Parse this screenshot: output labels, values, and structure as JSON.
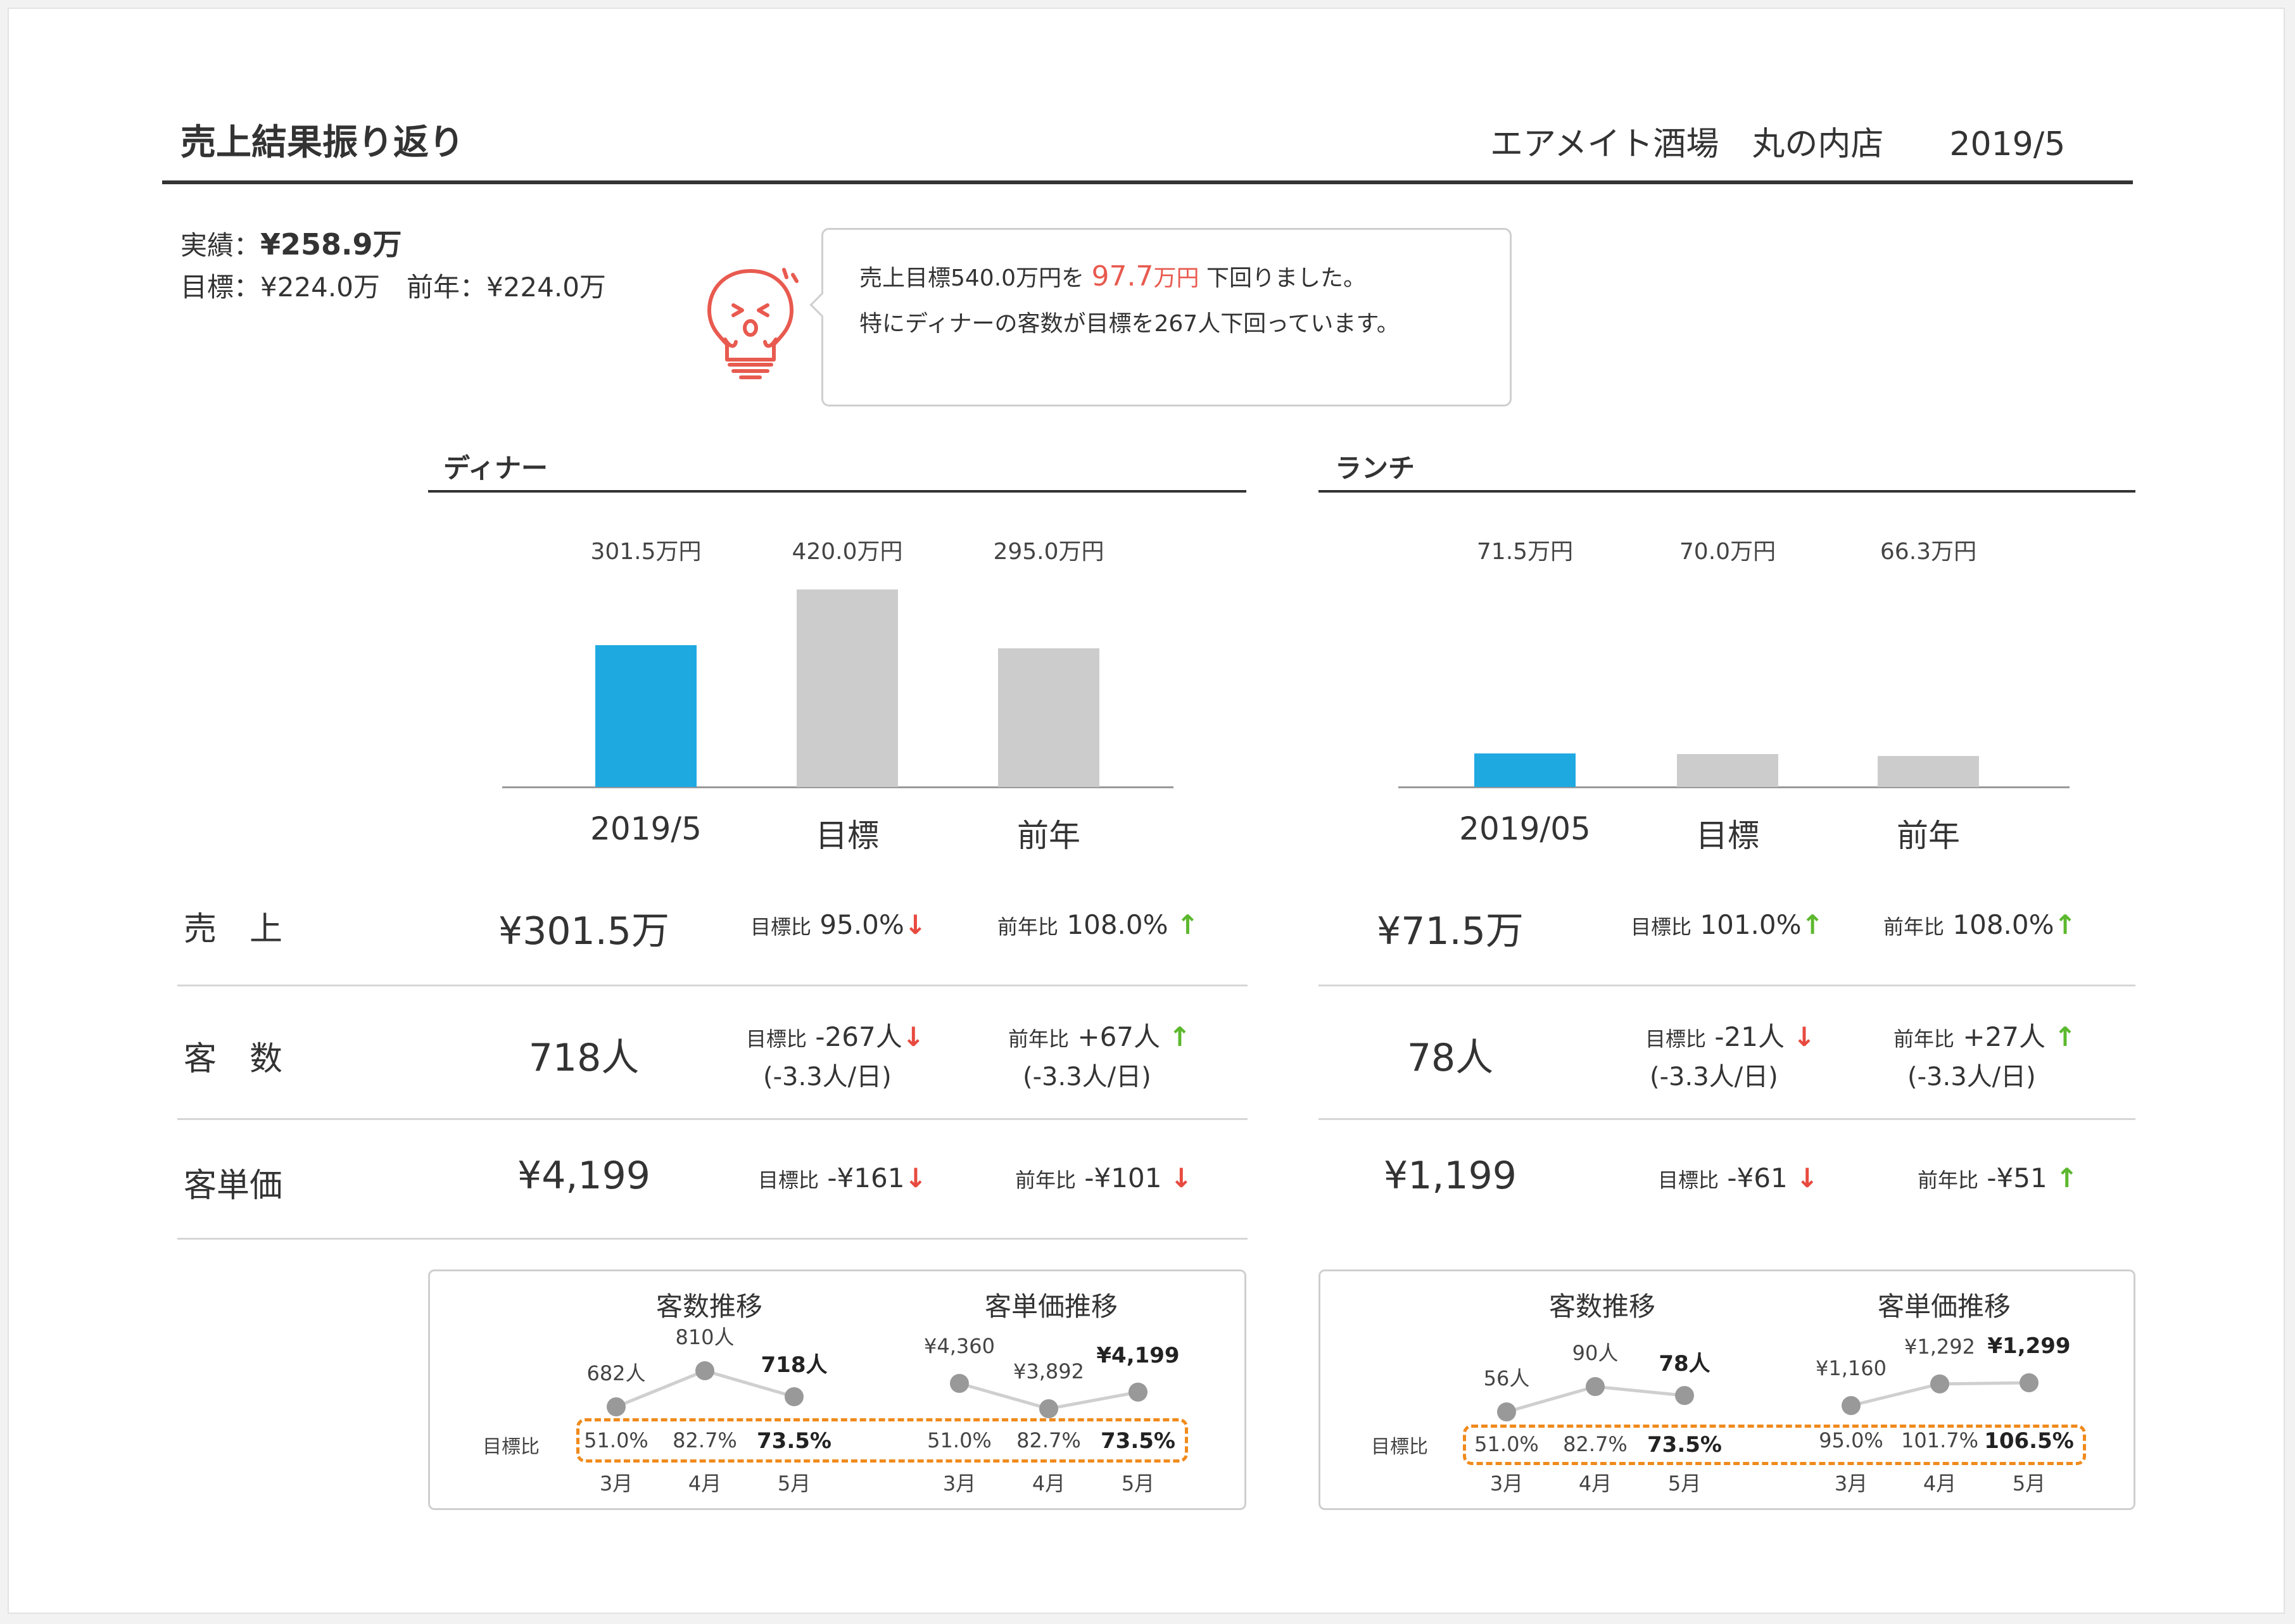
{
  "header": {
    "title": "売上結果振り返り",
    "store": "エアメイト酒場　丸の内店",
    "period": "2019/5"
  },
  "summary": {
    "actual_label": "実績：",
    "actual_value": "¥258.9万",
    "target_line": "目標：¥224.0万　前年：¥224.0万"
  },
  "comment": {
    "line1_prefix": "売上目標540.0万円を",
    "line1_highlight": "97.7",
    "line1_unit": "万円",
    "line1_suffix": "下回りました。",
    "line2": "特にディナーの客数が目標を267人下回っています。",
    "mascot_icon": "lightbulb-mascot-icon"
  },
  "colors": {
    "actual_bar": "#1fa9e1",
    "other_bar": "#cccccc",
    "down": "#e84a3f",
    "up": "#5cb82d",
    "highlight_box": "#f08a1c"
  },
  "row_labels": {
    "sales": "売　上",
    "customers": "客　数",
    "unit_price": "客単価"
  },
  "chart_data": [
    {
      "type": "bar",
      "title": "ディナー",
      "categories": [
        "2019/5",
        "目標",
        "前年"
      ],
      "values": [
        301.5,
        420.0,
        295.0
      ],
      "value_labels": [
        "301.5万円",
        "420.0万円",
        "295.0万円"
      ],
      "highlight_index": 0
    },
    {
      "type": "bar",
      "title": "ランチ",
      "categories": [
        "2019/05",
        "目標",
        "前年"
      ],
      "values": [
        71.5,
        70.0,
        66.3
      ],
      "value_labels": [
        "71.5万円",
        "70.0万円",
        "66.3万円"
      ],
      "highlight_index": 0
    },
    {
      "type": "line",
      "title": "客数推移",
      "section": "ディナー",
      "x": [
        "3月",
        "4月",
        "5月"
      ],
      "values": [
        682,
        810,
        718
      ],
      "value_labels": [
        "682人",
        "810人",
        "718人"
      ],
      "target_ratio": [
        "51.0%",
        "82.7%",
        "73.5%"
      ]
    },
    {
      "type": "line",
      "title": "客単価推移",
      "section": "ディナー",
      "x": [
        "3月",
        "4月",
        "5月"
      ],
      "values": [
        4360,
        3892,
        4199
      ],
      "value_labels": [
        "¥4,360",
        "¥3,892",
        "¥4,199"
      ],
      "target_ratio": [
        "51.0%",
        "82.7%",
        "73.5%"
      ]
    },
    {
      "type": "line",
      "title": "客数推移",
      "section": "ランチ",
      "x": [
        "3月",
        "4月",
        "5月"
      ],
      "values": [
        56,
        90,
        78
      ],
      "value_labels": [
        "56人",
        "90人",
        "78人"
      ],
      "target_ratio": [
        "51.0%",
        "82.7%",
        "73.5%"
      ]
    },
    {
      "type": "line",
      "title": "客単価推移",
      "section": "ランチ",
      "x": [
        "3月",
        "4月",
        "5月"
      ],
      "values": [
        1160,
        1292,
        1299
      ],
      "value_labels": [
        "¥1,160",
        "¥1,292",
        "¥1,299"
      ],
      "target_ratio": [
        "95.0%",
        "101.7%",
        "106.5%"
      ]
    }
  ],
  "dinner": {
    "sales": {
      "value": "¥301.5万",
      "target_label": "目標比",
      "target": "95.0%",
      "target_dir": "down",
      "prev_label": "前年比",
      "prev": "108.0%",
      "prev_dir": "up"
    },
    "customers": {
      "value": "718人",
      "target_label": "目標比",
      "target": "-267人",
      "target_sub": "(-3.3人/日)",
      "target_dir": "down",
      "prev_label": "前年比",
      "prev": "+67人",
      "prev_sub": "(-3.3人/日)",
      "prev_dir": "up"
    },
    "unit_price": {
      "value": "¥4,199",
      "target_label": "目標比",
      "target": "-¥161",
      "target_dir": "down",
      "prev_label": "前年比",
      "prev": "-¥101",
      "prev_dir": "down"
    }
  },
  "lunch": {
    "sales": {
      "value": "¥71.5万",
      "target_label": "目標比",
      "target": "101.0%",
      "target_dir": "up",
      "prev_label": "前年比",
      "prev": "108.0%",
      "prev_dir": "up"
    },
    "customers": {
      "value": "78人",
      "target_label": "目標比",
      "target": "-21人",
      "target_sub": "(-3.3人/日)",
      "target_dir": "down",
      "prev_label": "前年比",
      "prev": "+27人",
      "prev_sub": "(-3.3人/日)",
      "prev_dir": "up"
    },
    "unit_price": {
      "value": "¥1,199",
      "target_label": "目標比",
      "target": "-¥61",
      "target_dir": "down",
      "prev_label": "前年比",
      "prev": "-¥51",
      "prev_dir": "up"
    }
  },
  "trend_labels": {
    "target_ratio_label": "目標比"
  },
  "arrows": {
    "up": "↑",
    "down": "↓"
  }
}
